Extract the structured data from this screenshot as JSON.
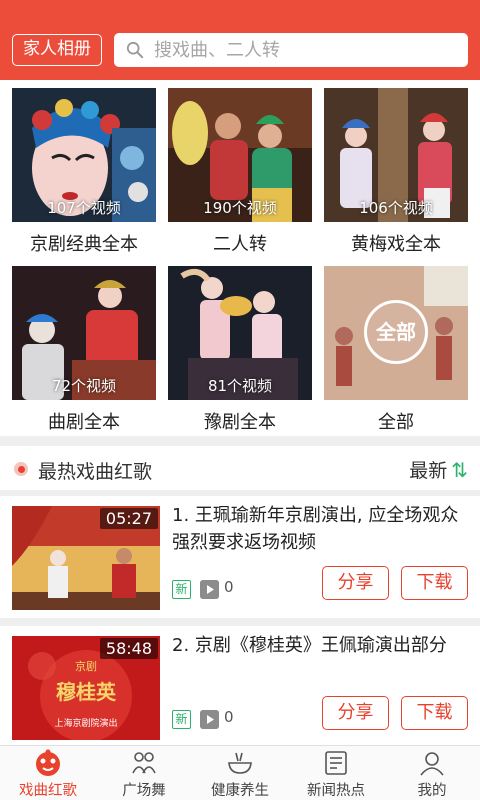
{
  "header": {
    "album_button": "家人相册",
    "search_placeholder": "搜戏曲、二人转",
    "accent_color": "#ec4d3b"
  },
  "categories": [
    {
      "label": "京剧经典全本",
      "count": "107个视频"
    },
    {
      "label": "二人转",
      "count": "190个视频"
    },
    {
      "label": "黄梅戏全本",
      "count": "106个视频"
    },
    {
      "label": "曲剧全本",
      "count": "72个视频"
    },
    {
      "label": "豫剧全本",
      "count": "81个视频"
    },
    {
      "label": "全部",
      "count": "",
      "badge": "全部"
    }
  ],
  "section": {
    "title": "最热戏曲红歌",
    "sort_label": "最新",
    "sort_icon": "sort-arrows-icon"
  },
  "videos": [
    {
      "duration": "05:27",
      "title": "1. 王珮瑜新年京剧演出, 应全场观众强烈要求返场视频",
      "new_tag": "新",
      "plays": "0",
      "share": "分享",
      "download": "下载"
    },
    {
      "duration": "58:48",
      "title": "2. 京剧《穆桂英》王佩瑜演出部分",
      "new_tag": "新",
      "plays": "0",
      "share": "分享",
      "download": "下载",
      "poster_text": "京剧",
      "poster_title": "穆桂英",
      "poster_caption": "上海京剧院演出"
    }
  ],
  "tabs": [
    {
      "label": "戏曲红歌",
      "icon": "opera-mask-icon",
      "active": true
    },
    {
      "label": "广场舞",
      "icon": "dancers-icon",
      "active": false
    },
    {
      "label": "健康养生",
      "icon": "bowl-icon",
      "active": false
    },
    {
      "label": "新闻热点",
      "icon": "news-icon",
      "active": false
    },
    {
      "label": "我的",
      "icon": "user-icon",
      "active": false
    }
  ],
  "colors": {
    "accent": "#e8422f",
    "green": "#2cb36b"
  }
}
